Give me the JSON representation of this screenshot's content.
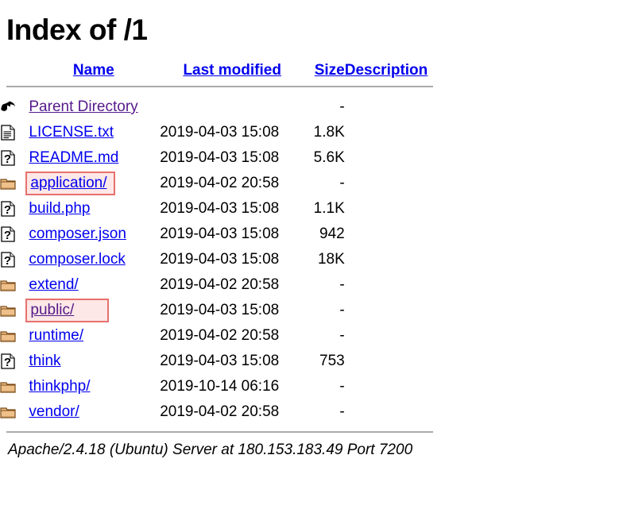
{
  "page": {
    "title": "Index of /1"
  },
  "table": {
    "headers": {
      "name": "Name",
      "last_modified": "Last modified",
      "size": "Size",
      "description": "Description"
    },
    "rows": [
      {
        "icon": "back-icon",
        "name": "Parent Directory",
        "visited": true,
        "date": "",
        "size": "-",
        "description": "",
        "highlight": false
      },
      {
        "icon": "text-file-icon",
        "name": "LICENSE.txt",
        "visited": false,
        "date": "2019-04-03 15:08",
        "size": "1.8K",
        "description": "",
        "highlight": false
      },
      {
        "icon": "unknown-file-icon",
        "name": "README.md",
        "visited": false,
        "date": "2019-04-03 15:08",
        "size": "5.6K",
        "description": "",
        "highlight": false
      },
      {
        "icon": "folder-icon",
        "name": "application/",
        "visited": false,
        "date": "2019-04-02 20:58",
        "size": "-",
        "description": "",
        "highlight": true
      },
      {
        "icon": "unknown-file-icon",
        "name": "build.php",
        "visited": false,
        "date": "2019-04-03 15:08",
        "size": "1.1K",
        "description": "",
        "highlight": false
      },
      {
        "icon": "unknown-file-icon",
        "name": "composer.json",
        "visited": false,
        "date": "2019-04-03 15:08",
        "size": "942",
        "description": "",
        "highlight": false
      },
      {
        "icon": "unknown-file-icon",
        "name": "composer.lock",
        "visited": false,
        "date": "2019-04-03 15:08",
        "size": "18K",
        "description": "",
        "highlight": false
      },
      {
        "icon": "folder-icon",
        "name": "extend/",
        "visited": false,
        "date": "2019-04-02 20:58",
        "size": "-",
        "description": "",
        "highlight": false
      },
      {
        "icon": "folder-icon",
        "name": "public/",
        "visited": true,
        "date": "2019-04-03 15:08",
        "size": "-",
        "description": "",
        "highlight": true
      },
      {
        "icon": "folder-icon",
        "name": "runtime/",
        "visited": false,
        "date": "2019-04-02 20:58",
        "size": "-",
        "description": "",
        "highlight": false
      },
      {
        "icon": "unknown-file-icon",
        "name": "think",
        "visited": false,
        "date": "2019-04-03 15:08",
        "size": "753",
        "description": "",
        "highlight": false
      },
      {
        "icon": "folder-icon",
        "name": "thinkphp/",
        "visited": false,
        "date": "2019-10-14 06:16",
        "size": "-",
        "description": "",
        "highlight": false
      },
      {
        "icon": "folder-icon",
        "name": "vendor/",
        "visited": false,
        "date": "2019-04-02 20:58",
        "size": "-",
        "description": "",
        "highlight": false
      }
    ]
  },
  "footer": {
    "text": "Apache/2.4.18 (Ubuntu) Server at 180.153.183.49 Port 7200"
  },
  "colors": {
    "link": "#0000ee",
    "visited_link": "#551a8b",
    "highlight_border": "#e8706c",
    "highlight_fill": "#fde8e7",
    "rule": "#aaaaaa"
  }
}
